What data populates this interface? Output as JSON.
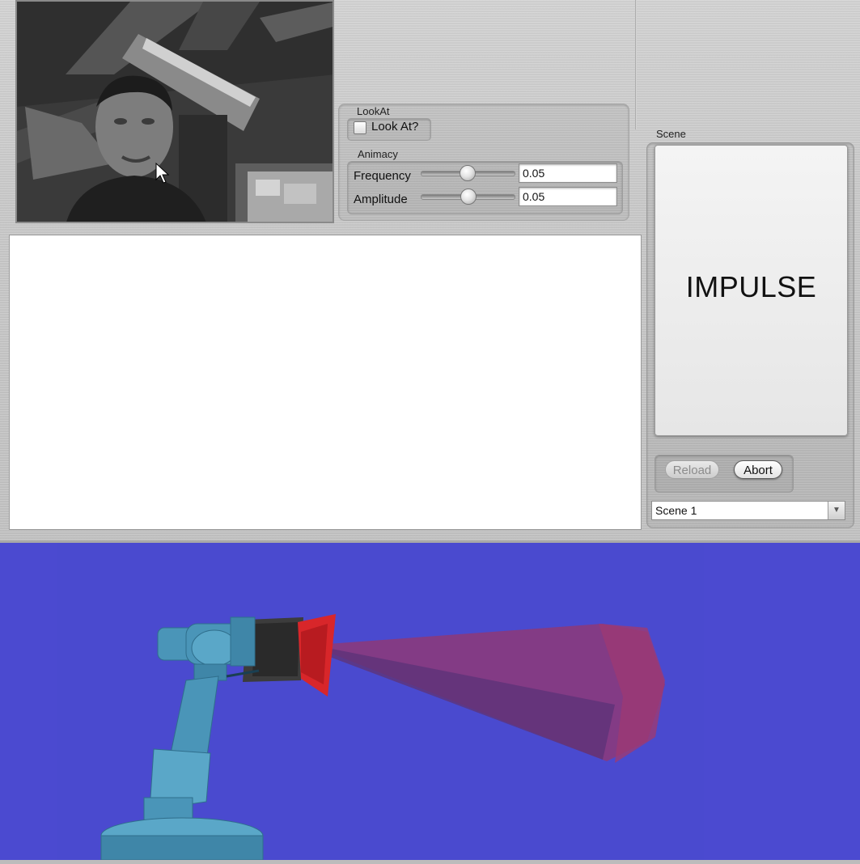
{
  "lookat": {
    "group_title": "LookAt",
    "checkbox_label": "Look At?",
    "checked": false
  },
  "animacy": {
    "group_title": "Animacy",
    "frequency": {
      "label": "Frequency",
      "value": "0.05",
      "slider_fraction": 0.5
    },
    "amplitude": {
      "label": "Amplitude",
      "value": "0.05",
      "slider_fraction": 0.5
    }
  },
  "scene": {
    "label": "Scene",
    "display_text": "IMPULSE",
    "reload_label": "Reload",
    "abort_label": "Abort",
    "selected_scene": "Scene 1"
  },
  "icons": {
    "checkbox": "checkbox-unchecked-icon",
    "dropdown": "chevron-down-icon",
    "cursor": "mouse-pointer-icon"
  },
  "colors": {
    "viewport_background": "#4b4ad0",
    "robot_arm": "#4a95b8",
    "spotlight_head": "#d8262a",
    "light_beam": "#8a3a7c"
  }
}
